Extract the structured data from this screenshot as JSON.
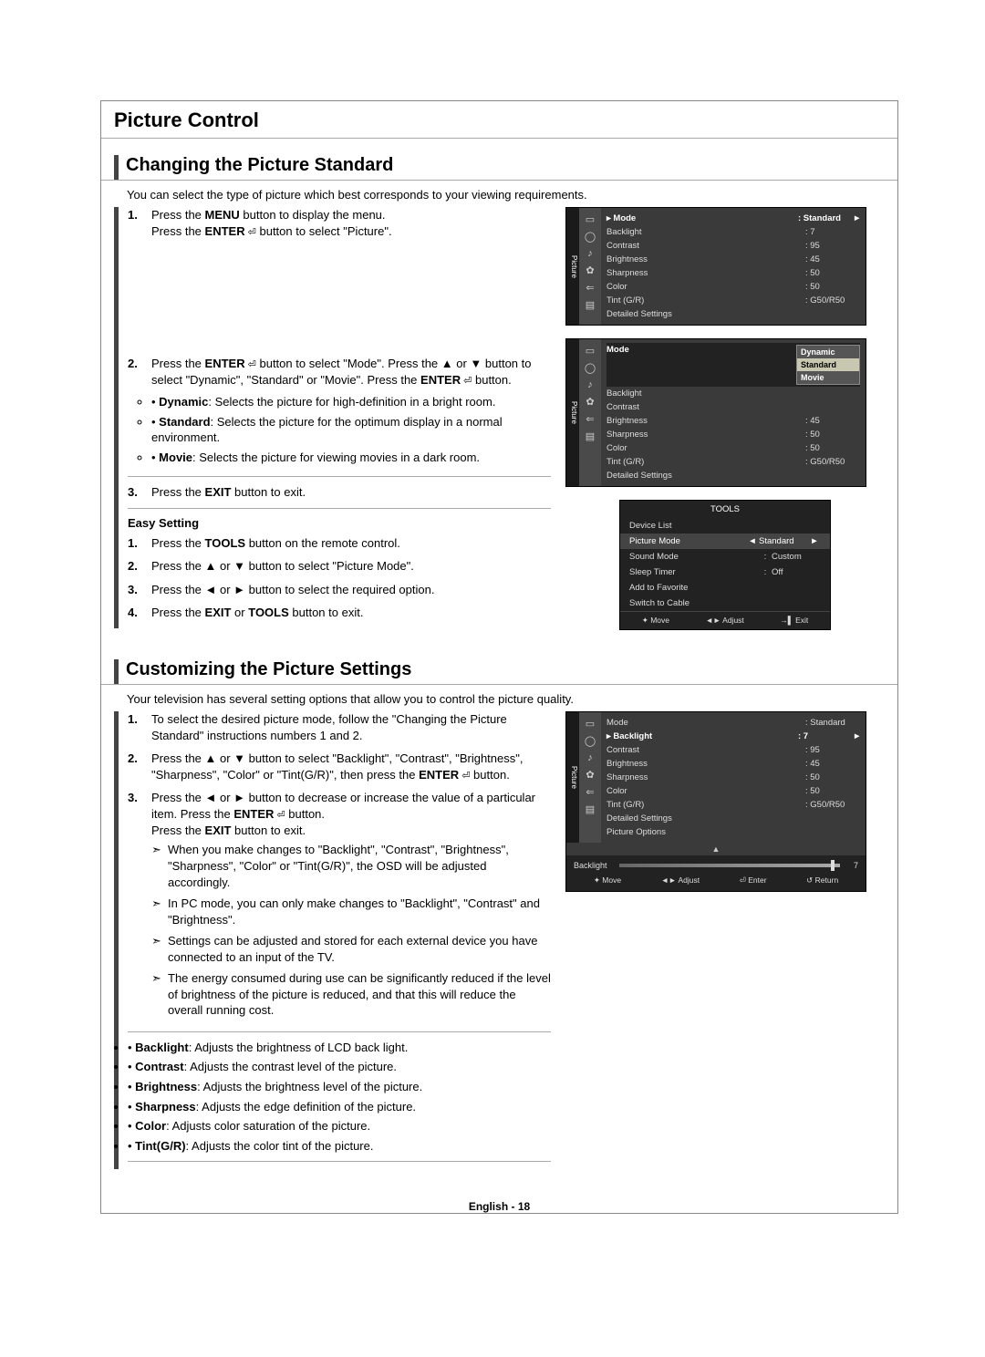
{
  "section_title": "Picture Control",
  "sec1": {
    "title": "Changing the Picture Standard",
    "intro": "You can select the type of picture which best corresponds to your viewing requirements.",
    "steps": {
      "s1a": "Press the ",
      "s1b": "MENU",
      "s1c": " button to display the menu.",
      "s1d": "Press the ",
      "s1e": "ENTER",
      "s1f": " button to select \"Picture\".",
      "s2a": "Press the ",
      "s2b": "ENTER",
      "s2c": " button to select \"Mode\". Press the ▲ or ▼ button to select \"Dynamic\", \"Standard\" or \"Movie\". Press the ",
      "s2d": "ENTER",
      "s2e": " button.",
      "d_dyn_b": "Dynamic",
      "d_dyn": ": Selects the picture for high-definition in a bright room.",
      "d_std_b": "Standard",
      "d_std": ": Selects the picture for the optimum display in a normal environment.",
      "d_mov_b": "Movie",
      "d_mov": ": Selects the picture for viewing movies in a dark room.",
      "s3a": "Press the ",
      "s3b": "EXIT",
      "s3c": " button to exit."
    },
    "easy_title": "Easy Setting",
    "easy": {
      "e1a": "Press the ",
      "e1b": "TOOLS",
      "e1c": " button on the remote control.",
      "e2": "Press the ▲ or ▼ button to select \"Picture Mode\".",
      "e3": "Press the ◄ or ► button to select the required option.",
      "e4a": "Press the ",
      "e4b": "EXIT",
      "e4c": " or ",
      "e4d": "TOOLS",
      "e4e": " button to exit."
    }
  },
  "sec2": {
    "title": "Customizing the Picture Settings",
    "intro": "Your television has several setting options that allow you to control the picture quality.",
    "s1": "To select the desired picture mode, follow the \"Changing the Picture Standard\" instructions numbers 1 and 2.",
    "s2a": "Press the ▲ or ▼ button to select \"Backlight\", \"Contrast\", \"Brightness\", \"Sharpness\", \"Color\" or \"Tint(G/R)\", then press the ",
    "s2b": "ENTER",
    "s2c": " button.",
    "s3a": "Press the ◄ or ► button to decrease or increase the value of a particular item. Press the ",
    "s3b": "ENTER",
    "s3c": " button.",
    "s3d": "Press the ",
    "s3e": "EXIT",
    "s3f": " button to exit.",
    "notes": [
      "When you make changes to \"Backlight\", \"Contrast\", \"Brightness\", \"Sharpness\", \"Color\" or \"Tint(G/R)\", the OSD will be adjusted accordingly.",
      "In PC mode, you can only make changes to \"Backlight\", \"Contrast\" and \"Brightness\".",
      "Settings can be adjusted and stored for each external device you have connected to an input of the TV.",
      "The energy consumed during use can be significantly reduced if the level of brightness of the picture is reduced, and that this will reduce the overall running cost."
    ],
    "defs": [
      {
        "b": "Backlight",
        "t": ": Adjusts the brightness of LCD back light."
      },
      {
        "b": "Contrast",
        "t": ": Adjusts the contrast level of the picture."
      },
      {
        "b": "Brightness",
        "t": ": Adjusts the brightness level of the picture."
      },
      {
        "b": "Sharpness",
        "t": ": Adjusts the edge definition of the picture."
      },
      {
        "b": "Color",
        "t": ": Adjusts color saturation of the picture."
      },
      {
        "b": "Tint(G/R)",
        "t": ": Adjusts the color tint of the picture."
      }
    ]
  },
  "osd1": {
    "tab": "Picture",
    "rows": [
      {
        "l": "Mode",
        "v": ": Standard",
        "hl": true
      },
      {
        "l": "Backlight",
        "v": ": 7"
      },
      {
        "l": "Contrast",
        "v": ": 95"
      },
      {
        "l": "Brightness",
        "v": ": 45"
      },
      {
        "l": "Sharpness",
        "v": ": 50"
      },
      {
        "l": "Color",
        "v": ": 50"
      },
      {
        "l": "Tint (G/R)",
        "v": ": G50/R50"
      },
      {
        "l": "Detailed Settings",
        "v": ""
      }
    ]
  },
  "osd2": {
    "tab": "Picture",
    "mode_label": "Mode",
    "popup": [
      "Dynamic",
      "Standard",
      "Movie"
    ],
    "rows": [
      {
        "l": "Backlight",
        "v": ""
      },
      {
        "l": "Contrast",
        "v": ""
      },
      {
        "l": "Brightness",
        "v": ": 45"
      },
      {
        "l": "Sharpness",
        "v": ": 50"
      },
      {
        "l": "Color",
        "v": ": 50"
      },
      {
        "l": "Tint (G/R)",
        "v": ": G50/R50"
      },
      {
        "l": "Detailed Settings",
        "v": ""
      }
    ]
  },
  "tools": {
    "title": "TOOLS",
    "rows": [
      {
        "l": "Device List",
        "v": ""
      },
      {
        "l": "Picture Mode",
        "v": "Standard",
        "sel": true
      },
      {
        "l": "Sound Mode",
        "v": "Custom"
      },
      {
        "l": "Sleep Timer",
        "v": "Off"
      },
      {
        "l": "Add to Favorite",
        "v": ""
      },
      {
        "l": "Switch to Cable",
        "v": ""
      }
    ],
    "foot": [
      "✦ Move",
      "◄► Adjust",
      "→▌ Exit"
    ]
  },
  "osd3": {
    "tab": "Picture",
    "rows": [
      {
        "l": "Mode",
        "v": ": Standard"
      },
      {
        "l": "Backlight",
        "v": ": 7",
        "hl": true
      },
      {
        "l": "Contrast",
        "v": ": 95"
      },
      {
        "l": "Brightness",
        "v": ": 45"
      },
      {
        "l": "Sharpness",
        "v": ": 50"
      },
      {
        "l": "Color",
        "v": ": 50"
      },
      {
        "l": "Tint (G/R)",
        "v": ": G50/R50"
      },
      {
        "l": "Detailed Settings",
        "v": ""
      },
      {
        "l": "Picture Options",
        "v": ""
      }
    ],
    "slider": {
      "label": "Backlight",
      "value": "7"
    },
    "foot": [
      "✦ Move",
      "◄► Adjust",
      "⏎ Enter",
      "↺ Return"
    ]
  },
  "footer": "English - 18"
}
